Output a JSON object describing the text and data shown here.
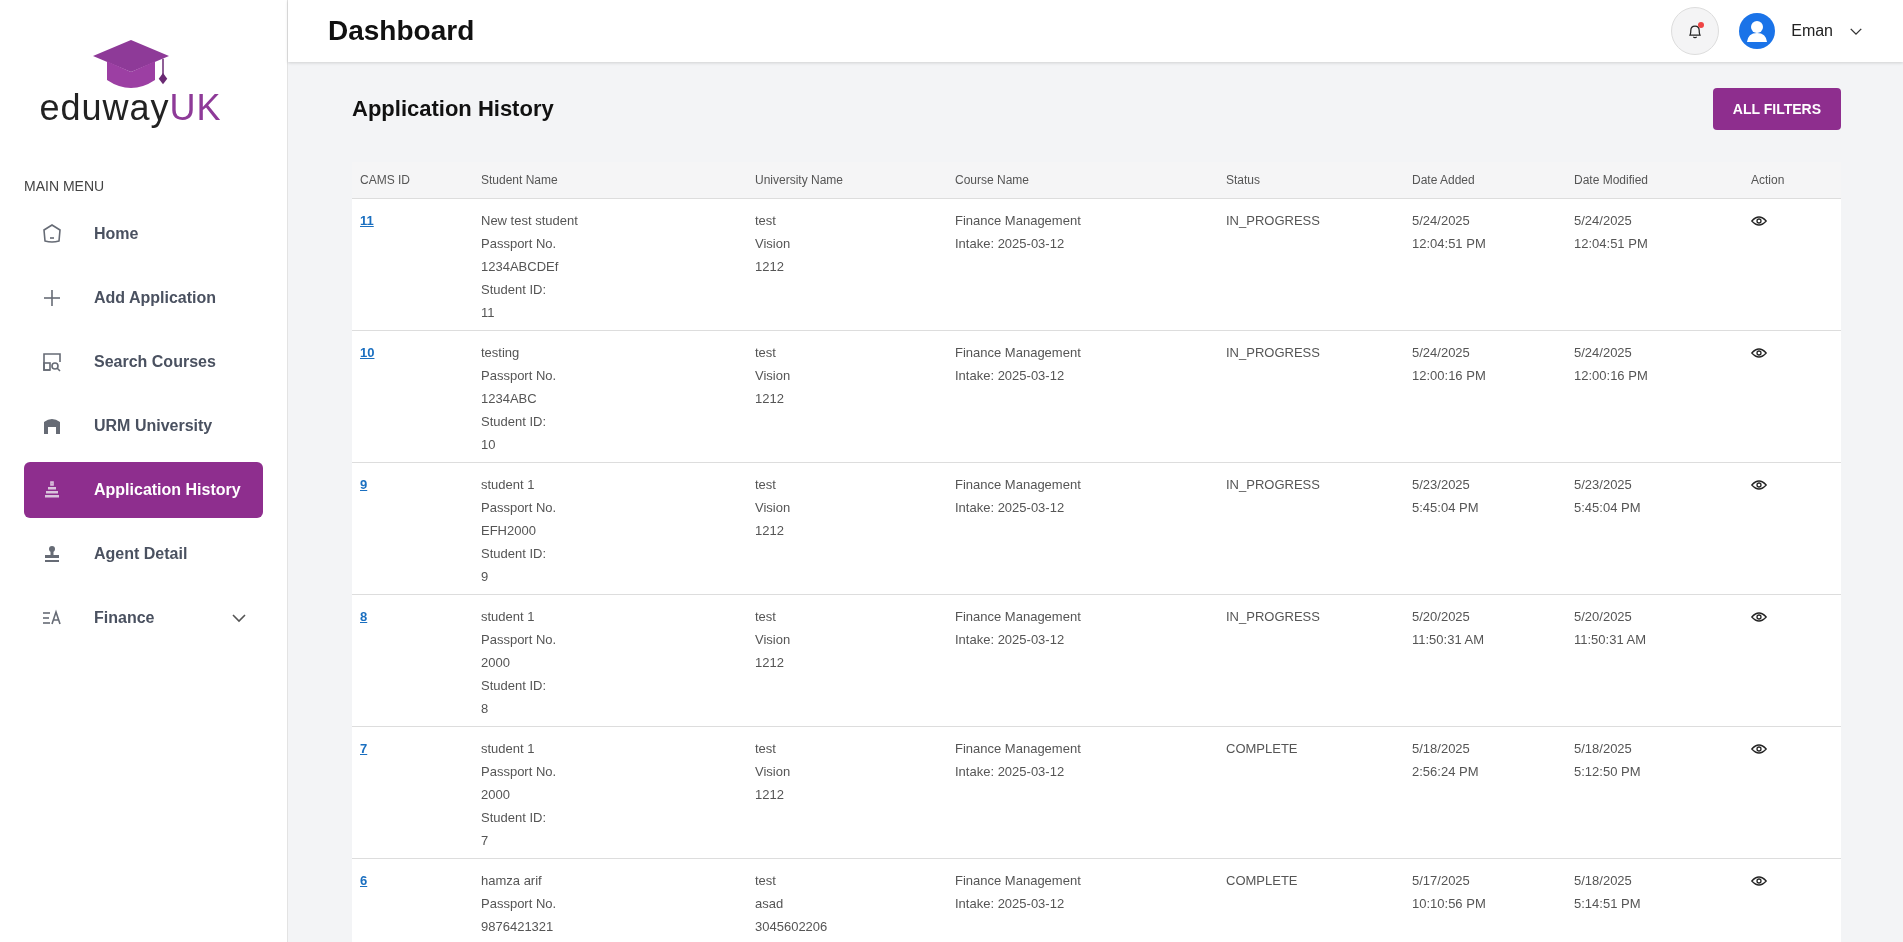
{
  "logo": {
    "text": "eduway",
    "suffix": "UK"
  },
  "sidebar": {
    "heading": "MAIN MENU",
    "items": [
      {
        "label": "Home",
        "selected": false,
        "expandable": false
      },
      {
        "label": "Add Application",
        "selected": false,
        "expandable": false
      },
      {
        "label": "Search Courses",
        "selected": false,
        "expandable": false
      },
      {
        "label": "URM University",
        "selected": false,
        "expandable": false
      },
      {
        "label": "Application History",
        "selected": true,
        "expandable": false
      },
      {
        "label": "Agent Detail",
        "selected": false,
        "expandable": false
      },
      {
        "label": "Finance",
        "selected": false,
        "expandable": true
      }
    ]
  },
  "header": {
    "title": "Dashboard",
    "notifications_unread": true,
    "user": "Eman"
  },
  "page": {
    "title": "Application History",
    "filter_button": "ALL FILTERS"
  },
  "table": {
    "columns": [
      "CAMS ID",
      "Student Name",
      "University Name",
      "Course Name",
      "Status",
      "Date Added",
      "Date Modified",
      "Action"
    ],
    "rows": [
      {
        "id": "11",
        "student": [
          "New test student",
          "Passport No.",
          "1234ABCDEf",
          "Student ID:",
          "11"
        ],
        "university": [
          "test",
          "Vision",
          "1212"
        ],
        "course": [
          "Finance Management",
          "Intake: 2025-03-12"
        ],
        "status": "IN_PROGRESS",
        "date_added": [
          "5/24/2025",
          "12:04:51 PM"
        ],
        "date_modified": [
          "5/24/2025",
          "12:04:51 PM"
        ]
      },
      {
        "id": "10",
        "student": [
          "testing",
          "Passport No.",
          "1234ABC",
          "Student ID:",
          "10"
        ],
        "university": [
          "test",
          "Vision",
          "1212"
        ],
        "course": [
          "Finance Management",
          "Intake: 2025-03-12"
        ],
        "status": "IN_PROGRESS",
        "date_added": [
          "5/24/2025",
          "12:00:16 PM"
        ],
        "date_modified": [
          "5/24/2025",
          "12:00:16 PM"
        ]
      },
      {
        "id": "9",
        "student": [
          "student 1",
          "Passport No.",
          "EFH2000",
          "Student ID:",
          "9"
        ],
        "university": [
          "test",
          "Vision",
          "1212"
        ],
        "course": [
          "Finance Management",
          "Intake: 2025-03-12"
        ],
        "status": "IN_PROGRESS",
        "date_added": [
          "5/23/2025",
          "5:45:04 PM"
        ],
        "date_modified": [
          "5/23/2025",
          "5:45:04 PM"
        ]
      },
      {
        "id": "8",
        "student": [
          "student 1",
          "Passport No.",
          "2000",
          "Student ID:",
          "8"
        ],
        "university": [
          "test",
          "Vision",
          "1212"
        ],
        "course": [
          "Finance Management",
          "Intake: 2025-03-12"
        ],
        "status": "IN_PROGRESS",
        "date_added": [
          "5/20/2025",
          "11:50:31 AM"
        ],
        "date_modified": [
          "5/20/2025",
          "11:50:31 AM"
        ]
      },
      {
        "id": "7",
        "student": [
          "student 1",
          "Passport No.",
          "2000",
          "Student ID:",
          "7"
        ],
        "university": [
          "test",
          "Vision",
          "1212"
        ],
        "course": [
          "Finance Management",
          "Intake: 2025-03-12"
        ],
        "status": "COMPLETE",
        "date_added": [
          "5/18/2025",
          "2:56:24 PM"
        ],
        "date_modified": [
          "5/18/2025",
          "5:12:50 PM"
        ]
      },
      {
        "id": "6",
        "student": [
          "hamza arif",
          "Passport No.",
          "9876421321"
        ],
        "university": [
          "test",
          "asad",
          "3045602206"
        ],
        "course": [
          "Finance Management",
          "Intake: 2025-03-12"
        ],
        "status": "COMPLETE",
        "date_added": [
          "5/17/2025",
          "10:10:56 PM"
        ],
        "date_modified": [
          "5/18/2025",
          "5:14:51 PM"
        ]
      }
    ]
  }
}
